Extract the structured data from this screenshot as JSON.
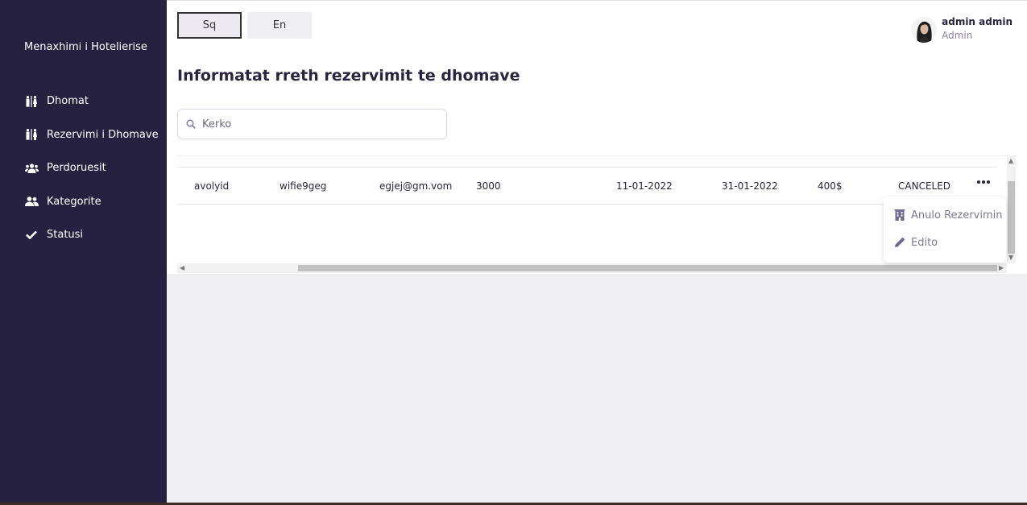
{
  "sidebar": {
    "brand": "Menaxhimi i Hotelierise",
    "items": [
      {
        "label": "Dhomat",
        "icon": "restroom-icon"
      },
      {
        "label": "Rezervimi i Dhomave",
        "icon": "restroom-icon"
      },
      {
        "label": "Perdoruesit",
        "icon": "users-icon"
      },
      {
        "label": "Kategorite",
        "icon": "user-friends-icon"
      },
      {
        "label": "Statusi",
        "icon": "check-icon"
      }
    ]
  },
  "header": {
    "languages": [
      "Sq",
      "En"
    ],
    "active_language": "Sq",
    "user": {
      "name": "admin admin",
      "role": "Admin"
    }
  },
  "main": {
    "title": "Informatat rreth rezervimit te dhomave",
    "search": {
      "placeholder": "Kerko",
      "value": ""
    },
    "table": {
      "rows": [
        {
          "cells": [
            "avolyid",
            "wifie9geg",
            "egjej@gm.vom",
            "3000",
            "11-01-2022",
            "31-01-2022",
            "400$",
            "CANCELED"
          ]
        }
      ]
    },
    "dropdown": {
      "items": [
        {
          "label": "Anulo Rezervimin",
          "icon": "hotel-icon"
        },
        {
          "label": "Edito",
          "icon": "pencil-icon"
        }
      ]
    }
  }
}
